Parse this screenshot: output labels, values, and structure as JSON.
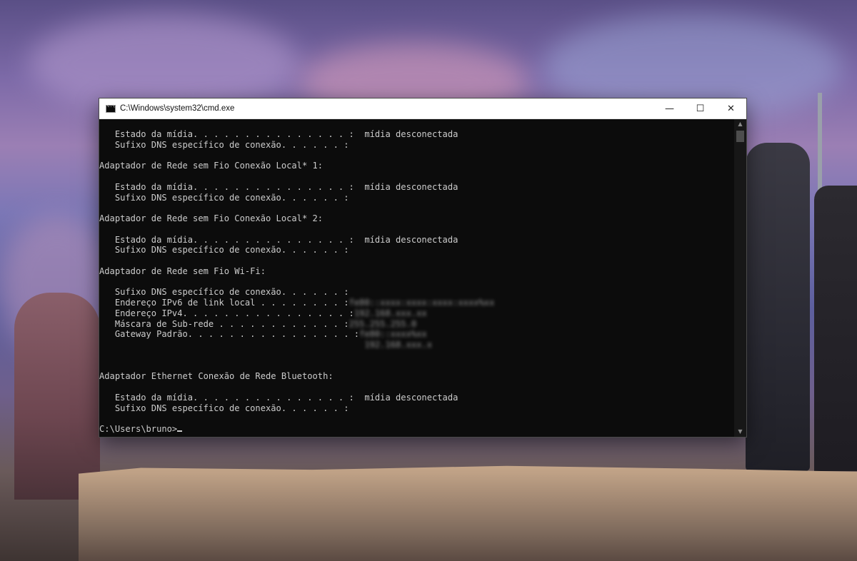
{
  "window": {
    "title": "C:\\Windows\\system32\\cmd.exe",
    "icon": "cmd-icon",
    "controls": {
      "minimize": "—",
      "maximize": "☐",
      "close": "✕"
    }
  },
  "console": {
    "lines": [
      "   Estado da mídia. . . . . . . . . . . . . . . :  mídia desconectada",
      "   Sufixo DNS específico de conexão. . . . . . :",
      "",
      "Adaptador de Rede sem Fio Conexão Local* 1:",
      "",
      "   Estado da mídia. . . . . . . . . . . . . . . :  mídia desconectada",
      "   Sufixo DNS específico de conexão. . . . . . :",
      "",
      "Adaptador de Rede sem Fio Conexão Local* 2:",
      "",
      "   Estado da mídia. . . . . . . . . . . . . . . :  mídia desconectada",
      "   Sufixo DNS específico de conexão. . . . . . :",
      "",
      "Adaptador de Rede sem Fio Wi-Fi:",
      "",
      "   Sufixo DNS específico de conexão. . . . . . :",
      "   Endereço IPv6 de link local . . . . . . . . :",
      "   Endereço IPv4. . . . . . . . . . . . . . . . :",
      "   Máscara de Sub-rede . . . . . . . . . . . . :",
      "   Gateway Padrão. . . . . . . . . . . . . . . . :",
      "",
      "",
      "",
      "Adaptador Ethernet Conexão de Rede Bluetooth:",
      "",
      "   Estado da mídia. . . . . . . . . . . . . . . :  mídia desconectada",
      "   Sufixo DNS específico de conexão. . . . . . :",
      "",
      "C:\\Users\\bruno>"
    ]
  },
  "scrollbar": {
    "up_arrow": "▲",
    "down_arrow": "▼"
  }
}
